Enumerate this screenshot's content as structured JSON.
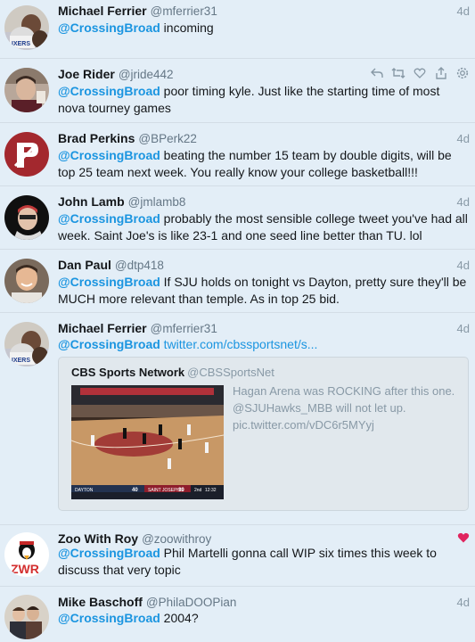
{
  "tweets": [
    {
      "name": "Michael Ferrier",
      "handle": "@mferrier31",
      "time": "4d",
      "mention": "@CrossingBroad",
      "text": " incoming"
    },
    {
      "name": "Joe Rider",
      "handle": "@jride442",
      "time": "",
      "mention": "@CrossingBroad",
      "text": " poor timing kyle. Just like the starting time of most nova tourney games"
    },
    {
      "name": "Brad Perkins",
      "handle": "@BPerk22",
      "time": "4d",
      "mention": "@CrossingBroad",
      "text": " beating the number 15 team by double digits, will be top 25 team next week. You really know your college basketball!!!"
    },
    {
      "name": "John Lamb",
      "handle": "@jmlamb8",
      "time": "4d",
      "mention": "@CrossingBroad",
      "text": " probably the most sensible college tweet you've had all week. Saint Joe's is like 23-1 and one seed line better than TU. lol"
    },
    {
      "name": "Dan Paul",
      "handle": "@dtp418",
      "time": "4d",
      "mention": "@CrossingBroad",
      "text": " If SJU holds on tonight vs Dayton, pretty sure they'll be MUCH more relevant than temple. As in top 25 bid."
    },
    {
      "name": "Michael Ferrier",
      "handle": "@mferrier31",
      "time": "4d",
      "mention": "@CrossingBroad",
      "text": "",
      "link": "twitter.com/cbssportsnet/s..."
    },
    {
      "name": "Zoo With Roy",
      "handle": "@zoowithroy",
      "time": "",
      "mention": "@CrossingBroad",
      "text": " Phil Martelli gonna call WIP six times this week to discuss that very topic"
    },
    {
      "name": "Mike Baschoff",
      "handle": "@PhilaDOOPian",
      "time": "4d",
      "mention": "@CrossingBroad",
      "text": " 2004?"
    }
  ],
  "quoted": {
    "name": "CBS Sports Network",
    "handle": "@CBSSportsNet",
    "text_line1": "Hagan Arena was ROCKING after this one.",
    "text_line2": "@SJUHawks_MBB will not let up.",
    "text_line3": "pic.twitter.com/vDC6r5MYyj",
    "scoreboard": {
      "team1": "DAYTON",
      "score1": "40",
      "team2": "SAINT JOSEPH'S",
      "score2": "30",
      "period": "2nd",
      "clock": "12:32"
    }
  },
  "colors": {
    "background": "#e3eef7",
    "accent": "#1b95e0",
    "like": "#e0245e"
  }
}
